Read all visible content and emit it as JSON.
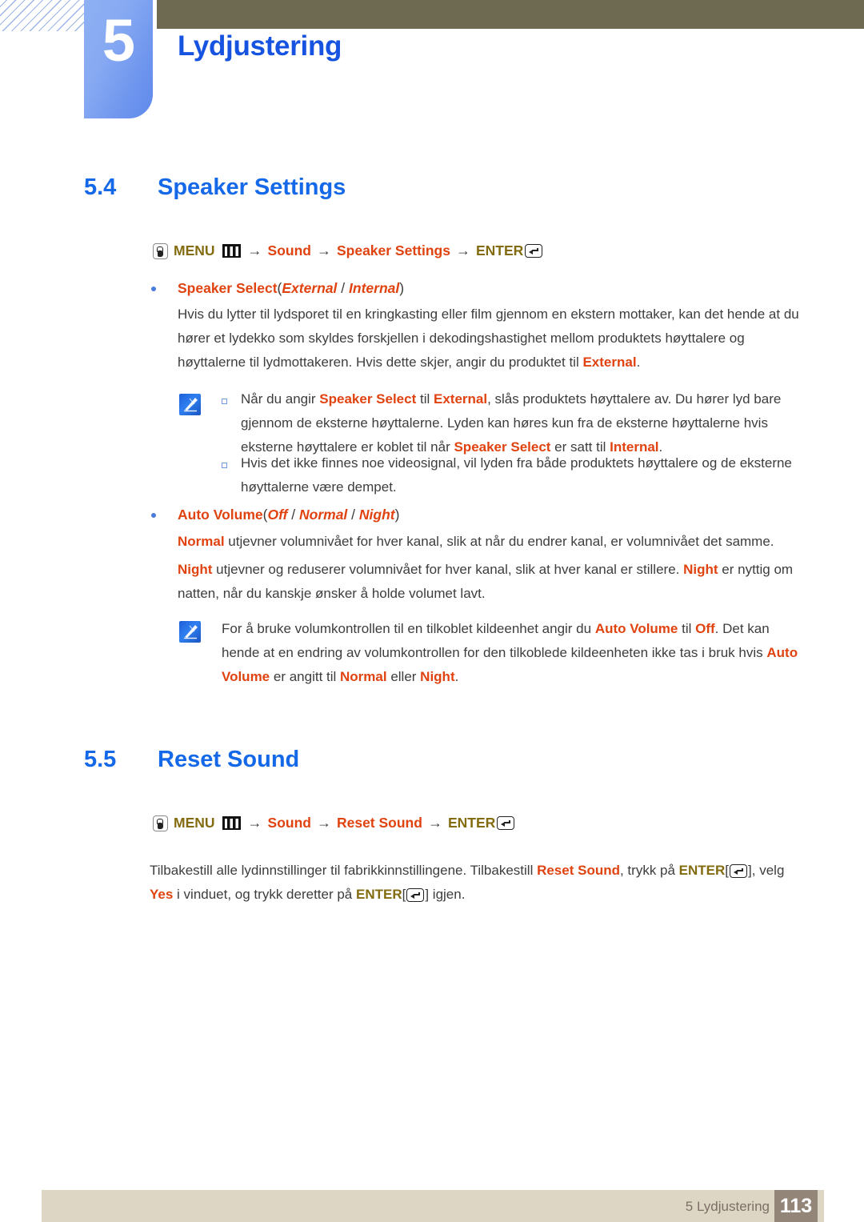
{
  "chapter": {
    "number": "5",
    "title": "Lydjustering",
    "accent_blue": "#1653e0",
    "badge_gradient_from": "#8eb0f3",
    "badge_gradient_to": "#5f89ec",
    "olive_bar_color": "#6e6a52"
  },
  "sections": [
    {
      "number": "5.4",
      "title": "Speaker Settings",
      "menu_path": {
        "hand_icon": "hand-press-icon",
        "menu_label": "MENU",
        "menu_bars_icon": "menu-bars-icon",
        "arrow": "→",
        "step1": "Sound",
        "step2": "Speaker Settings",
        "enter_label": "ENTER",
        "enter_icon": "enter-key-icon"
      }
    },
    {
      "number": "5.5",
      "title": "Reset Sound",
      "menu_path": {
        "hand_icon": "hand-press-icon",
        "menu_label": "MENU",
        "menu_bars_icon": "menu-bars-icon",
        "arrow": "→",
        "step1": "Sound",
        "step2": "Reset Sound",
        "enter_label": "ENTER",
        "enter_icon": "enter-key-icon"
      }
    }
  ],
  "speaker_select": {
    "bullet_label": "Speaker Select",
    "options_open": "(",
    "option1": "External",
    "option_sep": " / ",
    "option2": "Internal",
    "options_close": ")",
    "body_line1_a": "Hvis du lytter til lydsporet til en kringkasting eller film gjennom en ekstern mottaker, kan det hende at",
    "body_line2_a": "du hører et lydekko som skyldes forskjellen i dekodingshastighet mellom produktets høyttalere og",
    "body_line3_a": "høyttalerne til lydmottakeren. Hvis dette skjer, angir du produktet til ",
    "body_line3_kw": "External",
    "body_line3_b": "."
  },
  "note1": {
    "icon": "note-pen-icon",
    "items": [
      {
        "seg": [
          {
            "t": "Når du angir ",
            "kw": false
          },
          {
            "t": "Speaker Select",
            "kw": true
          },
          {
            "t": " til ",
            "kw": false
          },
          {
            "t": "External",
            "kw": true
          },
          {
            "t": ", slås produktets høyttalere av. Du hører lyd bare gjennom de eksterne høyttalerne. Lyden kan høres kun fra de eksterne høyttalerne hvis eksterne høyttalere er koblet til når ",
            "kw": false
          },
          {
            "t": "Speaker Select",
            "kw": true
          },
          {
            "t": " er satt til ",
            "kw": false
          },
          {
            "t": "Internal",
            "kw": true
          },
          {
            "t": ".",
            "kw": false
          }
        ]
      },
      {
        "seg": [
          {
            "t": "Hvis det ikke finnes noe videosignal, vil lyden fra både produktets høyttalere og de eksterne høyttalerne være dempet.",
            "kw": false
          }
        ]
      }
    ]
  },
  "auto_volume": {
    "bullet_label": "Auto Volume",
    "options_open": "(",
    "option1": "Off",
    "sep1": " / ",
    "option2": "Normal",
    "sep2": " / ",
    "option3": "Night",
    "options_close": ")",
    "para1": [
      {
        "t": "Normal",
        "kw": true
      },
      {
        "t": " utjevner volumnivået for hver kanal, slik at når du endrer kanal, er volumnivået det samme.",
        "kw": false
      }
    ],
    "para2": [
      {
        "t": "Night",
        "kw": true
      },
      {
        "t": " utjevner og reduserer volumnivået for hver kanal, slik at hver kanal er stillere. ",
        "kw": false
      },
      {
        "t": "Night",
        "kw": true
      },
      {
        "t": " er nyttig om natten, når du kanskje ønsker å holde volumet lavt.",
        "kw": false
      }
    ]
  },
  "note2": {
    "icon": "note-pen-icon",
    "seg": [
      {
        "t": "For å bruke volumkontrollen til en tilkoblet kildeenhet angir du ",
        "kw": false
      },
      {
        "t": "Auto Volume",
        "kw": true
      },
      {
        "t": " til ",
        "kw": false
      },
      {
        "t": "Off",
        "kw": true
      },
      {
        "t": ". Det kan hende at en endring av volumkontrollen for den tilkoblede kildeenheten ikke tas i bruk hvis ",
        "kw": false
      },
      {
        "t": "Auto Volume",
        "kw": true
      },
      {
        "t": " er angitt til ",
        "kw": false
      },
      {
        "t": "Normal",
        "kw": true
      },
      {
        "t": " eller ",
        "kw": false
      },
      {
        "t": "Night",
        "kw": true
      },
      {
        "t": ".",
        "kw": false
      }
    ]
  },
  "reset_sound_body": {
    "line1_a": "Tilbakestill alle lydinnstillinger til fabrikkinnstillingene. Tilbakestill ",
    "line1_kw": "Reset Sound",
    "line1_b": ", trykk på ",
    "line1_enter": "ENTER",
    "line1_c": ", velg ",
    "line2_kw": "Yes",
    "line2_a": " i vinduet, og trykk deretter på ",
    "line2_enter": "ENTER",
    "line2_b": " igjen.",
    "bracket_open": "[",
    "bracket_close": "]"
  },
  "footer": {
    "label": "5 Lydjustering",
    "page_number": "113",
    "bar_color": "#ded6c5",
    "pagebox_color": "#948579"
  },
  "colors": {
    "accent_orange": "#e04310",
    "accent_blue": "#1569e8",
    "olive_text": "#836b10",
    "body_text": "#3d3d3d"
  }
}
